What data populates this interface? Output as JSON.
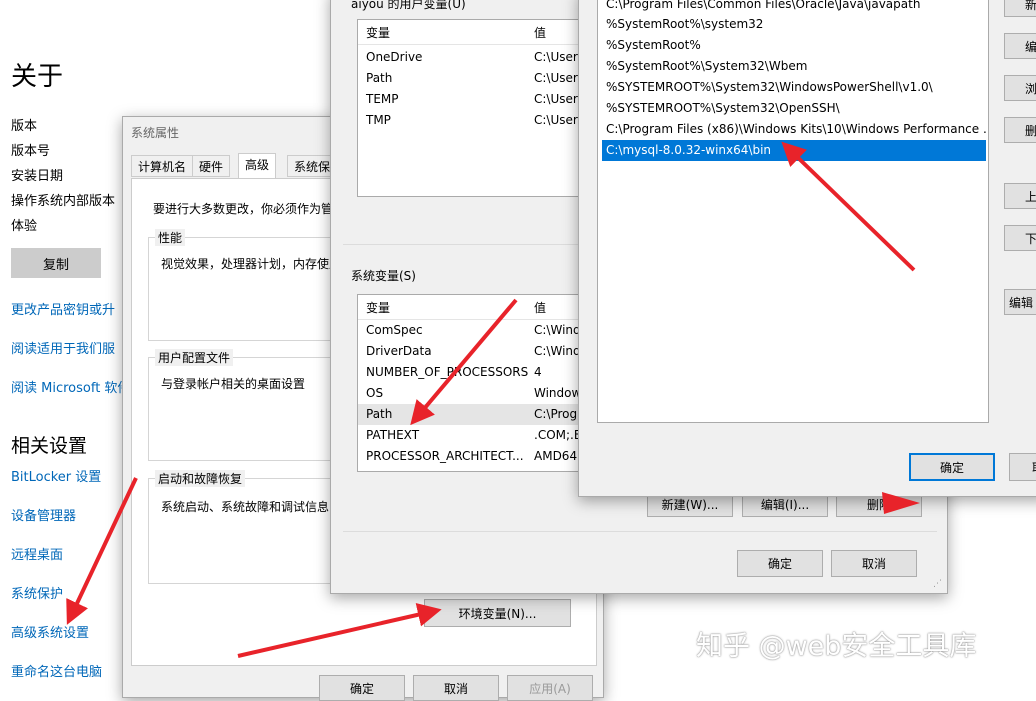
{
  "settings": {
    "title": "关于",
    "spec_labels": [
      "版本",
      "版本号",
      "安装日期",
      "操作系统内部版本",
      "体验"
    ],
    "copy_button": "复制",
    "links": [
      "更改产品密钥或升",
      "阅读适用于我们服",
      "阅读 Microsoft 软件"
    ],
    "related_title": "相关设置",
    "related_links": [
      "BitLocker 设置",
      "设备管理器",
      "远程桌面",
      "系统保护",
      "高级系统设置",
      "重命名这台电脑"
    ]
  },
  "sysprop": {
    "title": "系统属性",
    "tabs": [
      "计算机名",
      "硬件",
      "高级",
      "系统保"
    ],
    "active_tab": 2,
    "admin_note": "要进行大多数更改，你必须作为管",
    "performance": {
      "title": "性能",
      "desc": "视觉效果，处理器计划，内存使用"
    },
    "profiles": {
      "title": "用户配置文件",
      "desc": "与登录帐户相关的桌面设置"
    },
    "startup": {
      "title": "启动和故障恢复",
      "desc": "系统启动、系统故障和调试信息"
    },
    "env_button": "环境变量(N)...",
    "ok": "确定",
    "cancel": "取消",
    "apply": "应用(A)"
  },
  "envdlg": {
    "user_title": "aiyou 的用户变量(U)",
    "user_headers": [
      "变量",
      "值"
    ],
    "user_vars": [
      {
        "name": "OneDrive",
        "value": "C:\\Users"
      },
      {
        "name": "Path",
        "value": "C:\\Users"
      },
      {
        "name": "TEMP",
        "value": "C:\\Users"
      },
      {
        "name": "TMP",
        "value": "C:\\Users"
      }
    ],
    "sys_title": "系统变量(S)",
    "sys_headers": [
      "变量",
      "值"
    ],
    "sys_vars": [
      {
        "name": "ComSpec",
        "value": "C:\\Wind"
      },
      {
        "name": "DriverData",
        "value": "C:\\Wind"
      },
      {
        "name": "NUMBER_OF_PROCESSORS",
        "value": "4"
      },
      {
        "name": "OS",
        "value": "Window"
      },
      {
        "name": "Path",
        "value": "C:\\Prog"
      },
      {
        "name": "PATHEXT",
        "value": ".COM;.E"
      },
      {
        "name": "PROCESSOR_ARCHITECT...",
        "value": "AMD64"
      }
    ],
    "sys_new": "新建(W)...",
    "sys_edit": "编辑(I)...",
    "sys_delete": "删除",
    "ok": "确定",
    "cancel": "取消"
  },
  "editdlg": {
    "paths": [
      "C:\\Program Files\\Common Files\\Oracle\\Java\\javapath",
      "%SystemRoot%\\system32",
      "%SystemRoot%",
      "%SystemRoot%\\System32\\Wbem",
      "%SYSTEMROOT%\\System32\\WindowsPowerShell\\v1.0\\",
      "%SYSTEMROOT%\\System32\\OpenSSH\\",
      "C:\\Program Files (x86)\\Windows Kits\\10\\Windows Performance ...",
      "C:\\mysql-8.0.32-winx64\\bin"
    ],
    "selected_index": 7,
    "side_buttons": [
      "新",
      "编",
      "浏",
      "删",
      "上",
      "下",
      "编辑"
    ],
    "ok": "确定",
    "cancel": "取"
  },
  "watermark": "知乎 @web安全工具库",
  "colors": {
    "arrow": "#e8232a",
    "link": "#0067b8",
    "selection": "#0078d7"
  }
}
